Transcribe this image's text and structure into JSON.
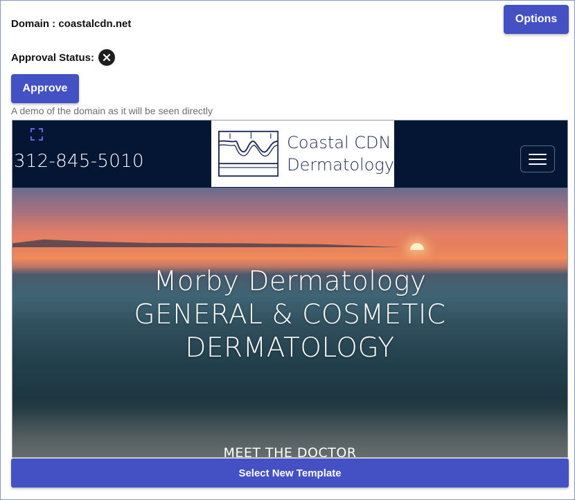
{
  "domain": {
    "label": "Domain : coastalcdn.net"
  },
  "approval": {
    "label": "Approval Status:",
    "status_icon": "close-circle-icon"
  },
  "buttons": {
    "options": "Options",
    "approve": "Approve",
    "select_template": "Select New Template"
  },
  "demo_caption": "A demo of the domain as it will be seen directly",
  "preview": {
    "phone": "312-845-5010",
    "logo": {
      "line1": "Coastal CDN",
      "line2": "Dermatology"
    },
    "menu_icon": "hamburger-icon",
    "expand_icon": "expand-icon",
    "hero": {
      "line1": "Morby Dermatology",
      "line2": "GENERAL & COSMETIC",
      "line3": "DERMATOLOGY"
    },
    "meet_doctor": "MEET THE DOCTOR"
  },
  "colors": {
    "button_bg": "#4351c4",
    "header_bg": "#041634",
    "logo_text": "#1c2a55",
    "frame_border": "#7f97c7"
  }
}
